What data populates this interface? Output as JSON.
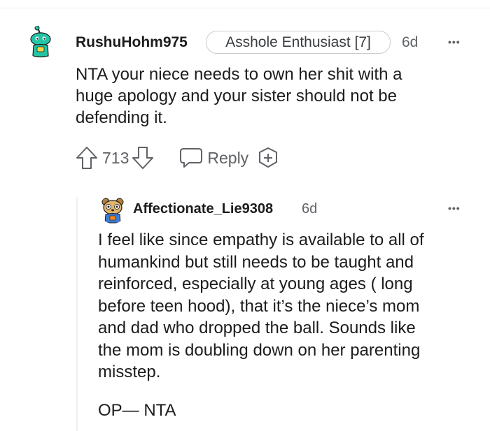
{
  "comment": {
    "username": "RushuHohm975",
    "flair": "Asshole Enthusiast [7]",
    "time": "6d",
    "more": "•••",
    "body_lines": [
      "NTA your niece needs to own her shit with a",
      "huge apology and your sister should not be",
      "defending it."
    ],
    "votes": "713",
    "reply_label": "Reply",
    "icons": [
      "upvote-icon",
      "downvote-icon",
      "reply-bubble-icon",
      "award-icon",
      "more-icon"
    ]
  },
  "reply": {
    "username": "Affectionate_Lie9308",
    "time": "6d",
    "more": "•••",
    "body_lines": [
      "I feel like since empathy is available to all of",
      "humankind but still needs to be taught and",
      "reinforced, especially at young ages ( long",
      "before teen hood), that it’s the niece’s mom",
      "and dad who dropped the ball. Sounds like",
      "the mom is doubling down on her parenting",
      "misstep."
    ],
    "signoff": "OP— NTA"
  },
  "colors": {
    "text": "#1c1c1c",
    "meta": "#5f6266",
    "avatar_alien": "#24c5a7",
    "avatar_bear": "#e0b46a"
  }
}
